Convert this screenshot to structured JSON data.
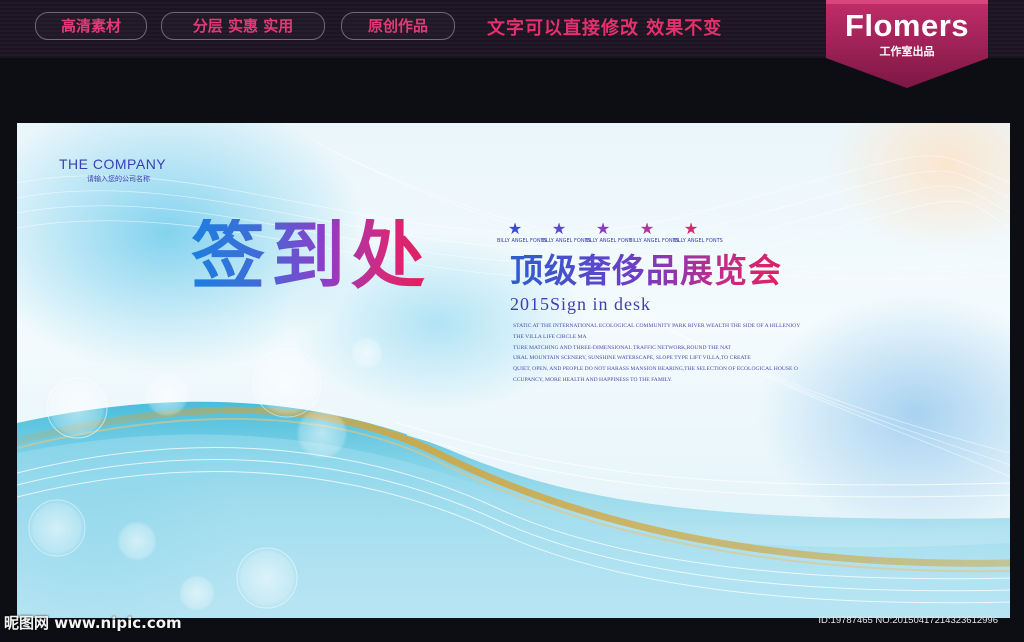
{
  "header": {
    "pills": [
      "高清素材",
      "分层 实惠 实用",
      "原创作品"
    ],
    "slogan": "文字可以直接修改  效果不变",
    "brand": {
      "name": "Flomers",
      "subtitle": "工作室出品"
    }
  },
  "poster": {
    "company": "THE COMPANY",
    "company_sub": "请输入您的公司名称",
    "headline": "签到处",
    "star_badges": [
      {
        "letter": "A",
        "caption": "BILLY ANGEL FONTS"
      },
      {
        "letter": "A",
        "caption": "BILLY ANGEL FONTS"
      },
      {
        "letter": "A",
        "caption": "BILLY ANGEL FONT"
      },
      {
        "letter": "A",
        "caption": "BILLY ANGEL FONTS"
      },
      {
        "letter": "A",
        "caption": "BILLY ANGEL FONTS"
      }
    ],
    "event_title": "顶级奢侈品展览会",
    "sign_text": "2015Sign in desk",
    "paragraph": [
      "STATIC AT THE INTERNATIONAL ECOLOGICAL COMMUNITY PARK RIVER WEALTH THE SIDE OF A HILLENJOY",
      "THE VILLA LIFE CIRCLE MA",
      "TURE MATCHING AND THREE-DIMENSIONAL TRAFFIC NETWORK,ROUND THE NAT",
      "URAL MOUNTAIN SCENERY, SUNSHINE WATERSCAPE, SLOPE TYPE LIFT VILLA,TO CREATE",
      "QUIET, OPEN, AND PEOPLE DO NOT HARASS MANSION BEARING,THE SELECTION OF ECOLOGICAL HOUSE O",
      "CCUPANCY, MORE HEALTH AND HAPPINESS TO THE FAMILY."
    ]
  },
  "footer": {
    "watermark": "昵图网 www.nipic.com",
    "id_text": "ID:19787465 NO:20150417214323612996"
  },
  "colors": {
    "pink_accent": "#e6306d",
    "brand_banner": "#a8205a",
    "headline_start": "#1e7ee0",
    "headline_end": "#e61c5a"
  }
}
